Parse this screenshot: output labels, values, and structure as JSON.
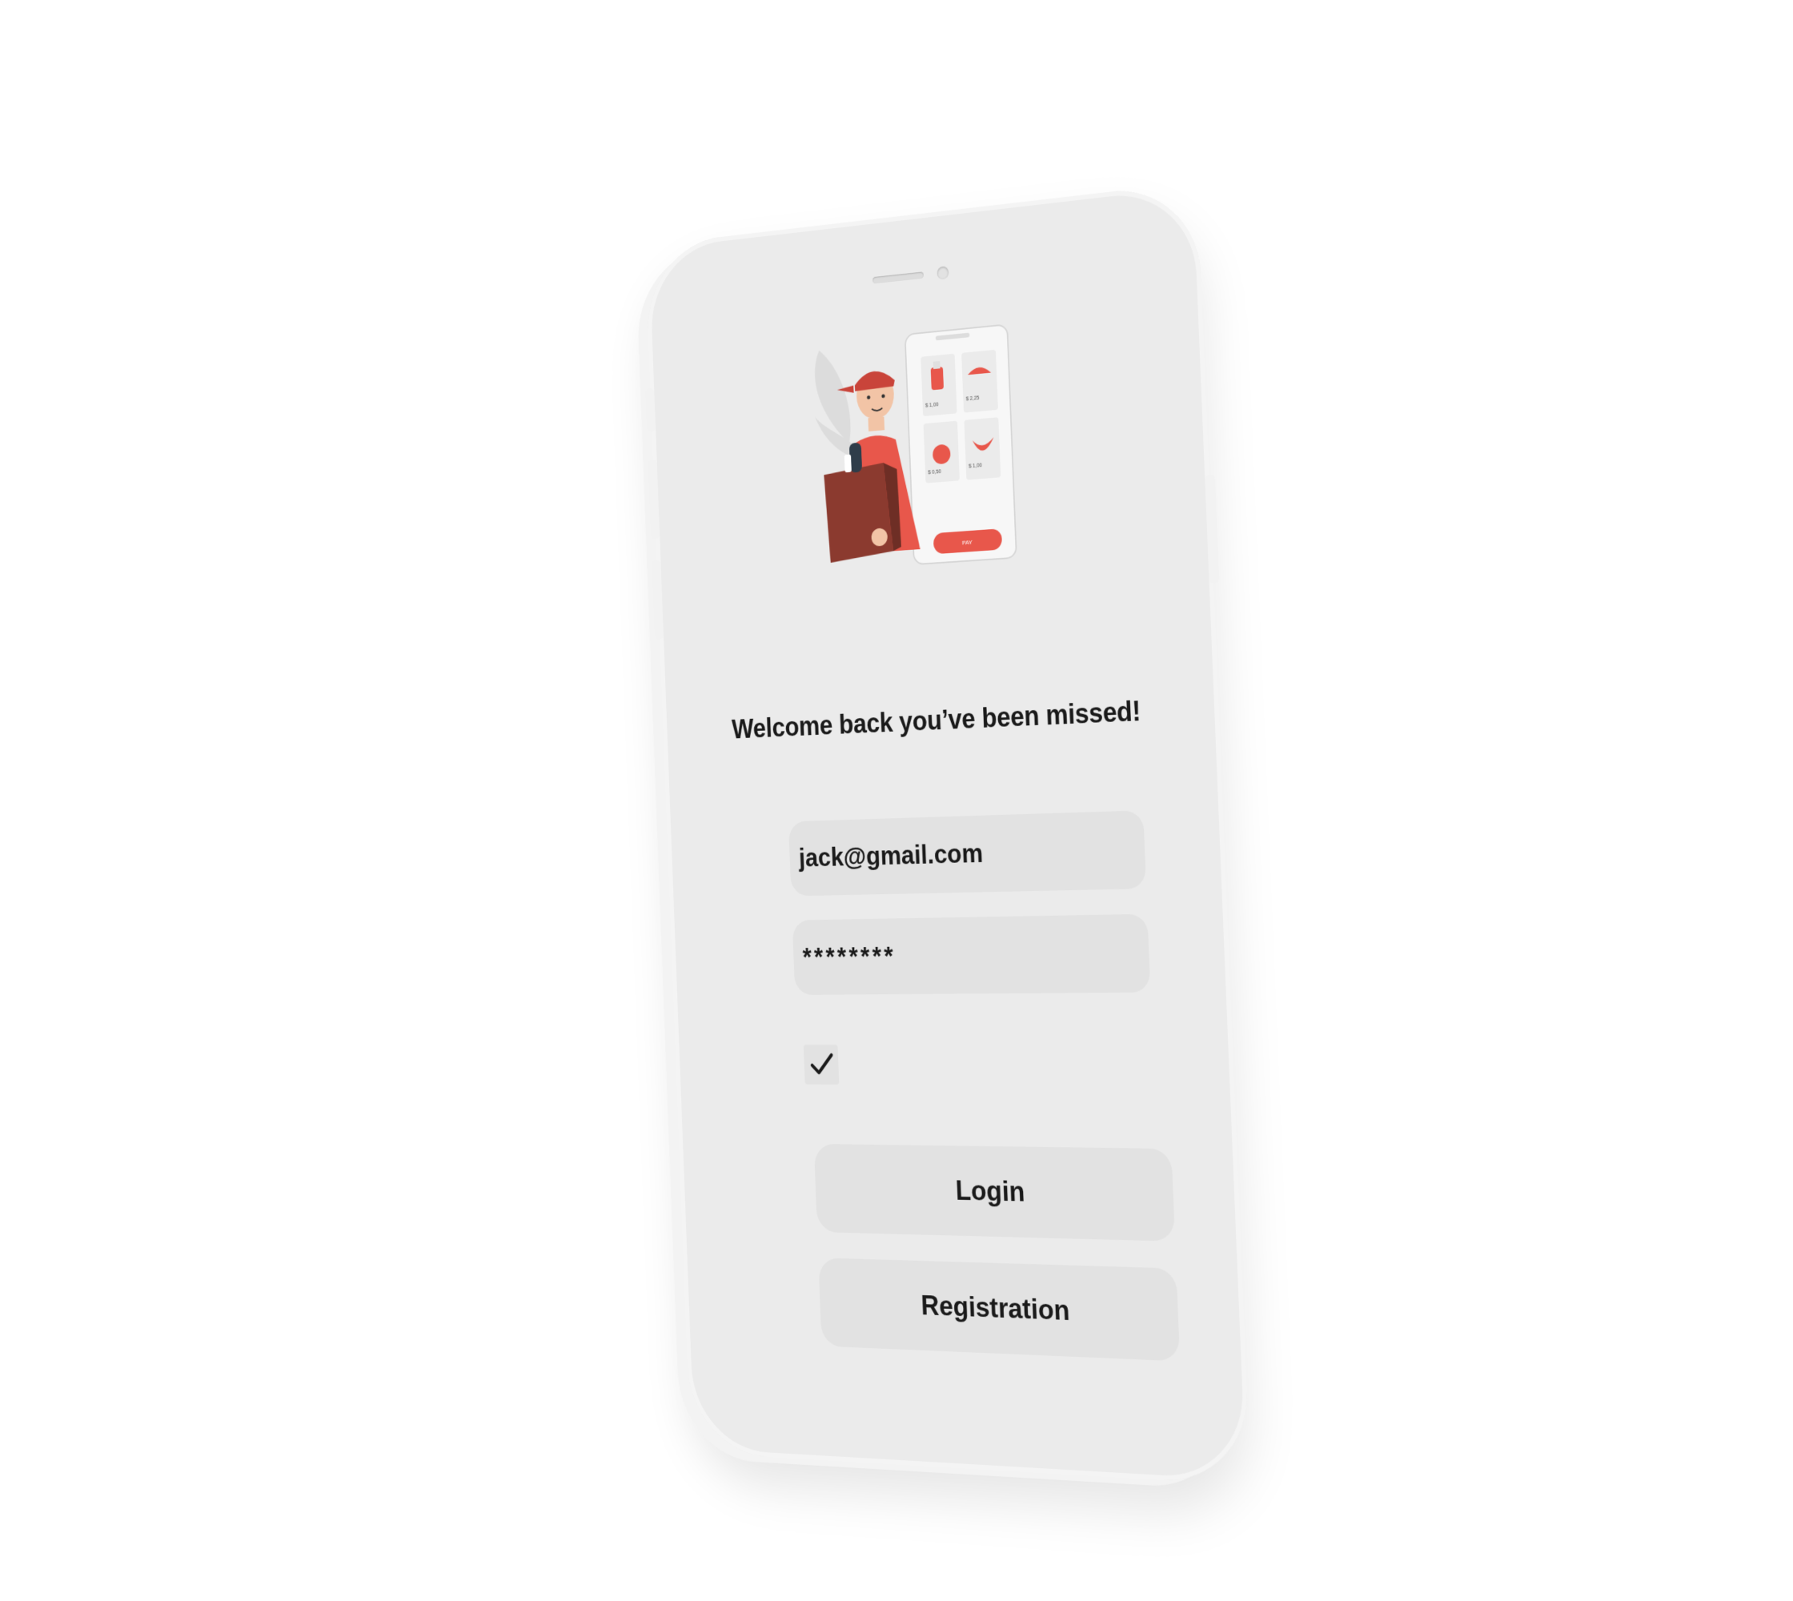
{
  "welcome": {
    "text": "Welcome back you’ve been missed!"
  },
  "form": {
    "email_value": "jack@gmail.com",
    "password_value": "********",
    "remember_checked": true
  },
  "buttons": {
    "login_label": "Login",
    "registration_label": "Registration"
  },
  "illustration": {
    "prices": [
      "$ 1,00",
      "$ 2,25",
      "$ 0,50",
      "$ 1,00"
    ],
    "pay_label": "PAY"
  },
  "colors": {
    "accent": "#e8574b",
    "accent_dark": "#8b3a2f",
    "surface": "#ebebeb",
    "field": "#e2e2e2",
    "text": "#1a1a1a"
  }
}
